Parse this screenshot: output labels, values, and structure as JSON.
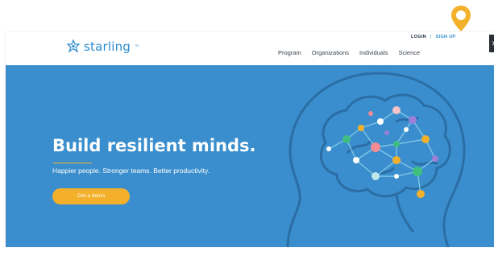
{
  "brand": {
    "name": "starling",
    "tm": "™"
  },
  "header": {
    "login": "LOGIN",
    "separator": "|",
    "signup": "SIGN UP",
    "nav": [
      "Program",
      "Organizations",
      "Individuals",
      "Science"
    ],
    "dark_tab_glyph": "✕"
  },
  "hero": {
    "title": "Build resilient minds.",
    "subtitle": "Happier people. Stronger teams. Better productivity.",
    "cta": "Get a demo"
  },
  "colors": {
    "brand_blue": "#2c8ccf",
    "hero_blue": "#3a8ecd",
    "accent_orange": "#f4b02a",
    "brain_line": "#2a6ea5"
  },
  "icons": {
    "logo_mark": "starling-logo-icon",
    "pin": "location-pin-icon",
    "brain": "brain-illustration"
  }
}
